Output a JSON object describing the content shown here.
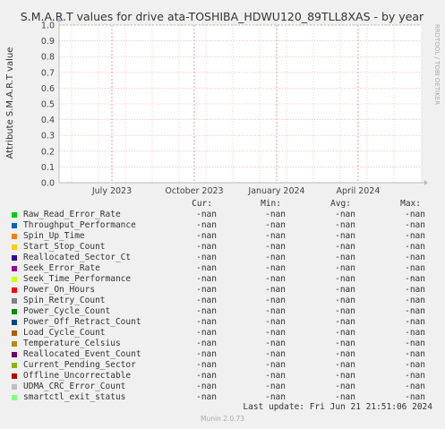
{
  "chart_data": {
    "type": "line",
    "title": "S.M.A.R.T values for drive ata-TOSHIBA_HDWU120_89TLL8XAS - by year",
    "ylabel": "Attribute S.M.A.R.T value",
    "side_label": "RRDTOOL / TOBI OETIKER",
    "ylim": [
      0,
      1.0
    ],
    "yticks": [
      "0.0",
      "0.1",
      "0.2",
      "0.3",
      "0.4",
      "0.5",
      "0.6",
      "0.7",
      "0.8",
      "0.9",
      "1.0"
    ],
    "xticks": [
      "July 2023",
      "October 2023",
      "January 2024",
      "April 2024"
    ],
    "grid": true,
    "series": [
      {
        "name": "Raw_Read_Error_Rate",
        "color": "#00cc00",
        "cur": "-nan",
        "min": "-nan",
        "avg": "-nan",
        "max": "-nan"
      },
      {
        "name": "Throughput_Performance",
        "color": "#0066b3",
        "cur": "-nan",
        "min": "-nan",
        "avg": "-nan",
        "max": "-nan"
      },
      {
        "name": "Spin_Up_Time",
        "color": "#ff8000",
        "cur": "-nan",
        "min": "-nan",
        "avg": "-nan",
        "max": "-nan"
      },
      {
        "name": "Start_Stop_Count",
        "color": "#ffcc00",
        "cur": "-nan",
        "min": "-nan",
        "avg": "-nan",
        "max": "-nan"
      },
      {
        "name": "Reallocated_Sector_Ct",
        "color": "#330099",
        "cur": "-nan",
        "min": "-nan",
        "avg": "-nan",
        "max": "-nan"
      },
      {
        "name": "Seek_Error_Rate",
        "color": "#990099",
        "cur": "-nan",
        "min": "-nan",
        "avg": "-nan",
        "max": "-nan"
      },
      {
        "name": "Seek_Time_Performance",
        "color": "#ccff00",
        "cur": "-nan",
        "min": "-nan",
        "avg": "-nan",
        "max": "-nan"
      },
      {
        "name": "Power_On_Hours",
        "color": "#ff0000",
        "cur": "-nan",
        "min": "-nan",
        "avg": "-nan",
        "max": "-nan"
      },
      {
        "name": "Spin_Retry_Count",
        "color": "#808080",
        "cur": "-nan",
        "min": "-nan",
        "avg": "-nan",
        "max": "-nan"
      },
      {
        "name": "Power_Cycle_Count",
        "color": "#008f00",
        "cur": "-nan",
        "min": "-nan",
        "avg": "-nan",
        "max": "-nan"
      },
      {
        "name": "Power_Off_Retract_Count",
        "color": "#00487d",
        "cur": "-nan",
        "min": "-nan",
        "avg": "-nan",
        "max": "-nan"
      },
      {
        "name": "Load_Cycle_Count",
        "color": "#b35a00",
        "cur": "-nan",
        "min": "-nan",
        "avg": "-nan",
        "max": "-nan"
      },
      {
        "name": "Temperature_Celsius",
        "color": "#b38f00",
        "cur": "-nan",
        "min": "-nan",
        "avg": "-nan",
        "max": "-nan"
      },
      {
        "name": "Reallocated_Event_Count",
        "color": "#6b006b",
        "cur": "-nan",
        "min": "-nan",
        "avg": "-nan",
        "max": "-nan"
      },
      {
        "name": "Current_Pending_Sector",
        "color": "#8fb300",
        "cur": "-nan",
        "min": "-nan",
        "avg": "-nan",
        "max": "-nan"
      },
      {
        "name": "Offline_Uncorrectable",
        "color": "#b30000",
        "cur": "-nan",
        "min": "-nan",
        "avg": "-nan",
        "max": "-nan"
      },
      {
        "name": "UDMA_CRC_Error_Count",
        "color": "#bebebe",
        "cur": "-nan",
        "min": "-nan",
        "avg": "-nan",
        "max": "-nan"
      },
      {
        "name": "smartctl_exit_status",
        "color": "#80ff80",
        "cur": "-nan",
        "min": "-nan",
        "avg": "-nan",
        "max": "-nan"
      }
    ]
  },
  "legend_headers": {
    "cur": "Cur:",
    "min": "Min:",
    "avg": "Avg:",
    "max": "Max:"
  },
  "footer": {
    "last_update": "Last update: Fri Jun 21 21:51:06 2024",
    "munin": "Munin 2.0.73"
  }
}
